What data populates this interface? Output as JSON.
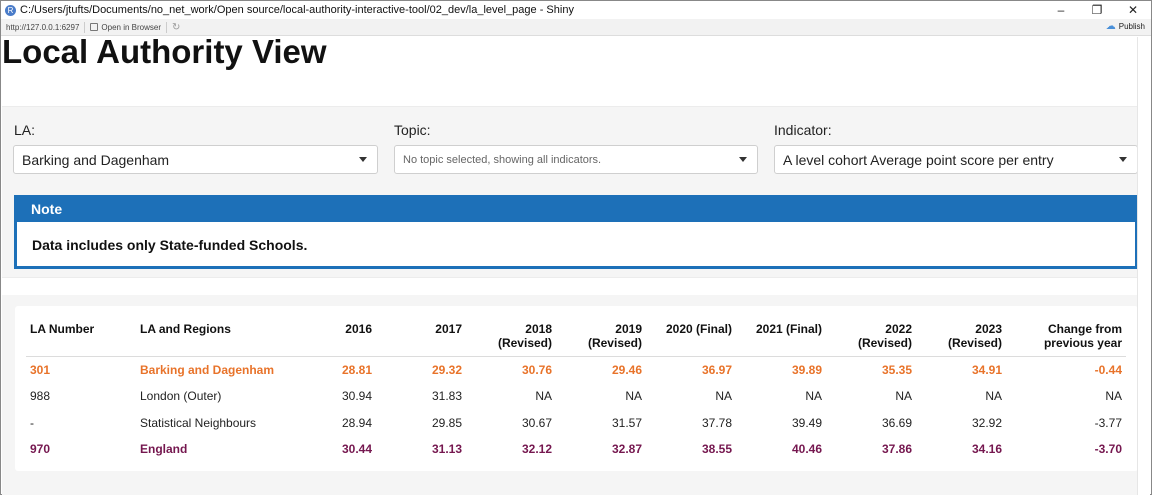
{
  "window": {
    "title": "C:/Users/jtufts/Documents/no_net_work/Open source/local-authority-interactive-tool/02_dev/la_level_page - Shiny",
    "controls": [
      "–",
      "❐",
      "✕"
    ]
  },
  "address_bar": {
    "url": "http://127.0.0.1:6297",
    "open_in_browser": "Open in Browser",
    "publish": "Publish"
  },
  "page": {
    "title": "Local Authority View"
  },
  "filters": {
    "la": {
      "label": "LA:",
      "value": "Barking and Dagenham"
    },
    "topic": {
      "label": "Topic:",
      "placeholder": "No topic selected, showing all indicators."
    },
    "indicator": {
      "label": "Indicator:",
      "value": "A level cohort Average point score per entry"
    }
  },
  "note": {
    "heading": "Note",
    "body": "Data includes only State-funded Schools."
  },
  "colors": {
    "accent": "#1d70b8",
    "la_highlight": "#e8732a",
    "england_highlight": "#75174f"
  },
  "table": {
    "headers": [
      "LA Number",
      "LA and Regions",
      "2016",
      "2017",
      "2018 (Revised)",
      "2019 (Revised)",
      "2020 (Final)",
      "2021 (Final)",
      "2022 (Revised)",
      "2023 (Revised)",
      "Change from previous year"
    ],
    "rows": [
      [
        "301",
        "Barking and Dagenham",
        "28.81",
        "29.32",
        "30.76",
        "29.46",
        "36.97",
        "39.89",
        "35.35",
        "34.91",
        "-0.44"
      ],
      [
        "988",
        "London (Outer)",
        "30.94",
        "31.83",
        "NA",
        "NA",
        "NA",
        "NA",
        "NA",
        "NA",
        "NA"
      ],
      [
        "-",
        "Statistical Neighbours",
        "28.94",
        "29.85",
        "30.67",
        "31.57",
        "37.78",
        "39.49",
        "36.69",
        "32.92",
        "-3.77"
      ],
      [
        "970",
        "England",
        "30.44",
        "31.13",
        "32.12",
        "32.87",
        "38.55",
        "40.46",
        "37.86",
        "34.16",
        "-3.70"
      ]
    ]
  }
}
